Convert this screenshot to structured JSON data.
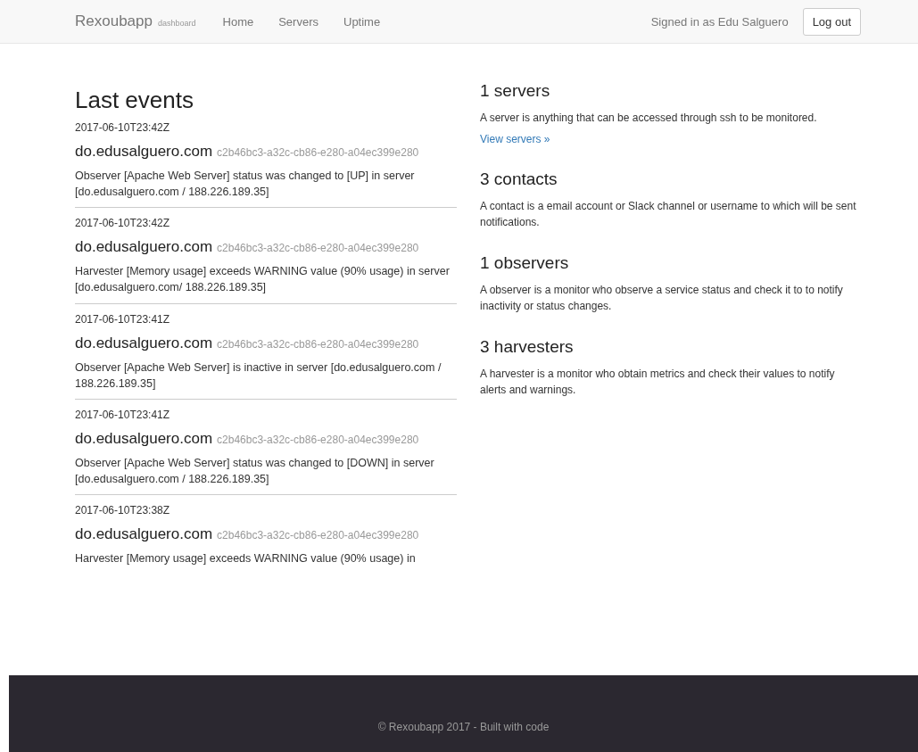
{
  "navbar": {
    "brand": "Rexoubapp",
    "brand_sub": "dashboard",
    "links": [
      {
        "label": "Home",
        "selected": false
      },
      {
        "label": "Servers",
        "selected": false
      },
      {
        "label": "Uptime",
        "selected": false
      }
    ],
    "signed_in": "Signed in as Edu Salguero",
    "logout": "Log out"
  },
  "events": {
    "title": "Last events",
    "items": [
      {
        "time": "2017-06-10T23:42Z",
        "host": "do.edusalguero.com",
        "id": "c2b46bc3-a32c-cb86-e280-a04ec399e280",
        "message": "Observer [Apache Web Server] status was changed to [UP] in server [do.edusalguero.com / 188.226.189.35]"
      },
      {
        "time": "2017-06-10T23:42Z",
        "host": "do.edusalguero.com",
        "id": "c2b46bc3-a32c-cb86-e280-a04ec399e280",
        "message": "Harvester [Memory usage] exceeds WARNING value (90% usage) in server [do.edusalguero.com/ 188.226.189.35]"
      },
      {
        "time": "2017-06-10T23:41Z",
        "host": "do.edusalguero.com",
        "id": "c2b46bc3-a32c-cb86-e280-a04ec399e280",
        "message": "Observer [Apache Web Server] is inactive in server [do.edusalguero.com / 188.226.189.35]"
      },
      {
        "time": "2017-06-10T23:41Z",
        "host": "do.edusalguero.com",
        "id": "c2b46bc3-a32c-cb86-e280-a04ec399e280",
        "message": "Observer [Apache Web Server] status was changed to [DOWN] in server [do.edusalguero.com / 188.226.189.35]"
      },
      {
        "time": "2017-06-10T23:38Z",
        "host": "do.edusalguero.com",
        "id": "c2b46bc3-a32c-cb86-e280-a04ec399e280",
        "message": "Harvester [Memory usage] exceeds WARNING value (90% usage) in"
      }
    ]
  },
  "summary": [
    {
      "title": "1 servers",
      "text": "A server is anything that can be accessed through ssh to be monitored.",
      "link": "View servers »"
    },
    {
      "title": "3 contacts",
      "text": "A contact is a email account or Slack channel or username to which will be sent notifications."
    },
    {
      "title": "1 observers",
      "text": "A observer is a monitor who observe a service status and check it to to notify inactivity or status changes."
    },
    {
      "title": "3 harvesters",
      "text": "A harvester is a monitor who obtain metrics and check their values to notify alerts and warnings."
    }
  ],
  "footer": {
    "text": "© Rexoubapp 2017 - Built with code"
  }
}
